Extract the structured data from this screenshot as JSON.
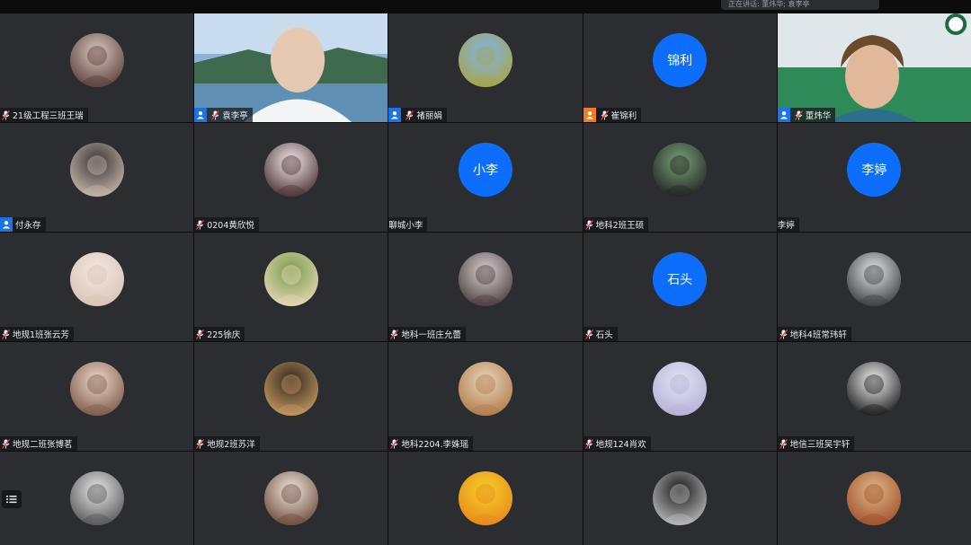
{
  "colors": {
    "accent": "#0d6efd",
    "tile_bg": "#2b2d31",
    "host_badge": "#1a73e8",
    "cohost_badge": "#f07b24"
  },
  "top_speaker": "正在讲话: 董炜华; 袁李亭",
  "participants": [
    {
      "name": "21级工程三班王瑞",
      "avatar": "photo",
      "mic": true
    },
    {
      "name": "袁李亭",
      "avatar": "video",
      "mic": true,
      "role": "host"
    },
    {
      "name": "褚丽娟",
      "avatar": "photo",
      "mic": true,
      "role": "host"
    },
    {
      "name": "崔锦利",
      "avatar": "text",
      "initials": "锦利",
      "mic": true,
      "role": "cohost"
    },
    {
      "name": "董炜华",
      "avatar": "video",
      "mic": true,
      "role": "host"
    },
    {
      "name": "付永存",
      "avatar": "photo",
      "mic": false,
      "role": "host"
    },
    {
      "name": "0204黄欣悦",
      "avatar": "photo",
      "mic": true
    },
    {
      "name": "聊城小李",
      "avatar": "text",
      "initials": "小李",
      "mic": false
    },
    {
      "name": "地科2班王硕",
      "avatar": "photo",
      "mic": true
    },
    {
      "name": "李婷",
      "avatar": "text",
      "initials": "李婷",
      "mic": false
    },
    {
      "name": "地规1班张云芳",
      "avatar": "photo",
      "mic": true
    },
    {
      "name": "225徐庆",
      "avatar": "photo",
      "mic": true
    },
    {
      "name": "地科一班庄允蕾",
      "avatar": "photo",
      "mic": true
    },
    {
      "name": "石头",
      "avatar": "text",
      "initials": "石头",
      "mic": true
    },
    {
      "name": "地科4班常玮轩",
      "avatar": "photo",
      "mic": true
    },
    {
      "name": "地规二班张博茗",
      "avatar": "photo",
      "mic": true
    },
    {
      "name": "地规2班苏洋",
      "avatar": "photo",
      "mic": true
    },
    {
      "name": "地科2204.李姝瑶",
      "avatar": "photo",
      "mic": true
    },
    {
      "name": "地规124肖欢",
      "avatar": "photo",
      "mic": true
    },
    {
      "name": "地信三班吴宇轩",
      "avatar": "photo",
      "mic": true
    },
    {
      "name": "",
      "avatar": "photo",
      "mic": false
    },
    {
      "name": "",
      "avatar": "photo",
      "mic": false
    },
    {
      "name": "",
      "avatar": "photo",
      "mic": false
    },
    {
      "name": "",
      "avatar": "photo",
      "mic": false
    },
    {
      "name": "",
      "avatar": "photo",
      "mic": false
    }
  ],
  "avatar_palettes": [
    [
      "#d9c7c2",
      "#5a3f3a"
    ],
    [
      "#6e8fb3",
      "#d8d0c8"
    ],
    [
      "#7fb2e8",
      "#a8a548"
    ],
    [
      "#0d6efd",
      "#0d6efd"
    ],
    [
      "#b9c9c2",
      "#2c8a5a"
    ],
    [
      "#3a3535",
      "#c9b8ad"
    ],
    [
      "#f3e9ea",
      "#4a2f34"
    ],
    [
      "#0d6efd",
      "#0d6efd"
    ],
    [
      "#7aa37a",
      "#222"
    ],
    [
      "#0d6efd",
      "#0d6efd"
    ],
    [
      "#f3e8e2",
      "#d9c2b5"
    ],
    [
      "#7a9a4a",
      "#e6d9b8"
    ],
    [
      "#d8d3d3",
      "#4a3b3b"
    ],
    [
      "#0d6efd",
      "#0d6efd"
    ],
    [
      "#e0e6ea",
      "#3b3b3b"
    ],
    [
      "#f0d7c9",
      "#7a5a4a"
    ],
    [
      "#2f2720",
      "#c99a62"
    ],
    [
      "#e8d6bd",
      "#b07a4a"
    ],
    [
      "#dfe3f2",
      "#b8b0d6"
    ],
    [
      "#f2f2f2",
      "#1a1a1a"
    ],
    [
      "#e8e8e8",
      "#555"
    ],
    [
      "#f0e6e0",
      "#6b4a3a"
    ],
    [
      "#f5d02a",
      "#e8881a"
    ],
    [
      "#1a1a1a",
      "#bdbdbd"
    ],
    [
      "#e0b888",
      "#a0502a"
    ]
  ]
}
